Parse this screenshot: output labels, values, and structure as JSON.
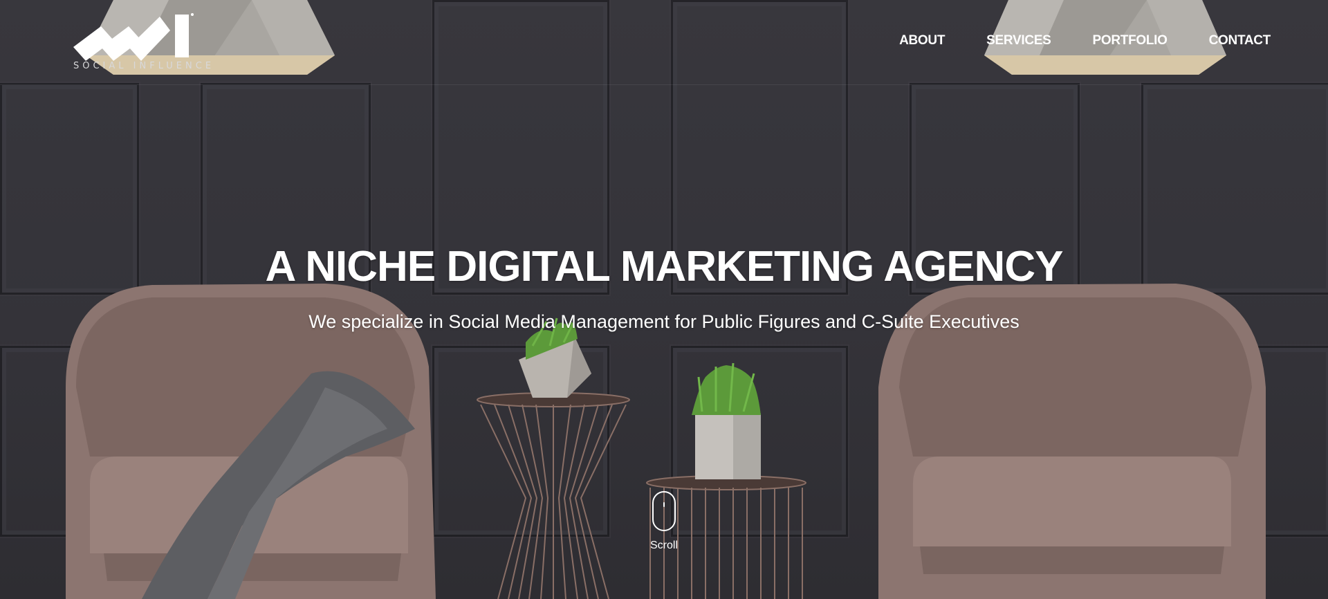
{
  "brand": {
    "logo_text": "SOCIAL INFLUENCE"
  },
  "nav": {
    "items": [
      {
        "label": "ABOUT"
      },
      {
        "label": "SERVICES"
      },
      {
        "label": "PORTFOLIO"
      },
      {
        "label": "CONTACT"
      }
    ]
  },
  "hero": {
    "headline": "A NICHE DIGITAL MARKETING AGENCY",
    "subline": "We specialize in Social Media Management for Public Figures and C-Suite Executives",
    "scroll_label": "Scroll"
  },
  "colors": {
    "text": "#ffffff",
    "wall": "#36353b",
    "chair": "#8c7570",
    "lamp": "#a9a6a1"
  },
  "icons": {
    "scroll": "mouse-scroll-icon"
  }
}
